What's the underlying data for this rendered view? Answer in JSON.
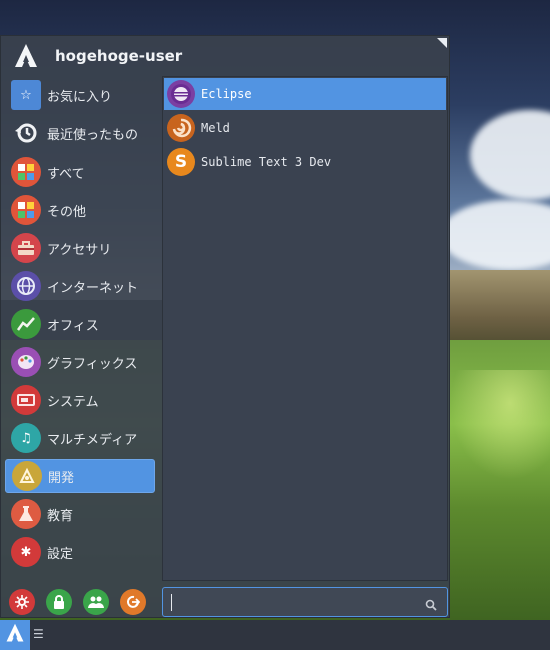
{
  "user": {
    "name": "hogehoge-user",
    "logo_icon": "arch-logo-icon"
  },
  "categories": [
    {
      "label": "お気に入り",
      "icon": "star-folder-icon",
      "color": "#4d88d6"
    },
    {
      "label": "最近使ったもの",
      "icon": "history-icon",
      "color": "#3a4250"
    },
    {
      "label": "すべて",
      "icon": "apps-grid-icon",
      "color": "#e0553a"
    },
    {
      "label": "その他",
      "icon": "apps-grid-icon",
      "color": "#e0553a"
    },
    {
      "label": "アクセサリ",
      "icon": "toolbox-icon",
      "color": "#d4454b"
    },
    {
      "label": "インターネット",
      "icon": "globe-icon",
      "color": "#5b4fa8"
    },
    {
      "label": "オフィス",
      "icon": "chart-line-icon",
      "color": "#3b9a3d"
    },
    {
      "label": "グラフィックス",
      "icon": "palette-icon",
      "color": "#9a4fb4"
    },
    {
      "label": "システム",
      "icon": "system-icon",
      "color": "#d23a3a"
    },
    {
      "label": "マルチメディア",
      "icon": "music-note-icon",
      "color": "#2ea6a6"
    },
    {
      "label": "開発",
      "icon": "development-icon",
      "color": "#c9a63a",
      "active": true
    },
    {
      "label": "教育",
      "icon": "flask-icon",
      "color": "#de5b42"
    },
    {
      "label": "設定",
      "icon": "settings-gear-icon",
      "color": "#d23a3a"
    }
  ],
  "apps": [
    {
      "label": "Eclipse",
      "icon": "eclipse-icon",
      "color": "#7b3fa2",
      "active": true
    },
    {
      "label": "Meld",
      "icon": "meld-icon",
      "color": "#c8641e"
    },
    {
      "label": "Sublime Text 3 Dev",
      "icon": "sublime-text-icon",
      "color": "#e8881d"
    }
  ],
  "actions": [
    {
      "name": "settings-action",
      "icon": "gear-icon",
      "color": "#d23a3a"
    },
    {
      "name": "lock-action",
      "icon": "lock-icon",
      "color": "#3aa54a"
    },
    {
      "name": "switch-user-action",
      "icon": "users-icon",
      "color": "#3aa54a"
    },
    {
      "name": "logout-action",
      "icon": "logout-icon",
      "color": "#e0792a"
    }
  ],
  "search": {
    "value": "",
    "placeholder": "",
    "icon": "search-icon"
  },
  "taskbar": {
    "start_icon": "arch-logo-icon",
    "indicator": "☰"
  },
  "colors": {
    "accent": "#5294e2",
    "panel": "#3a4250"
  }
}
